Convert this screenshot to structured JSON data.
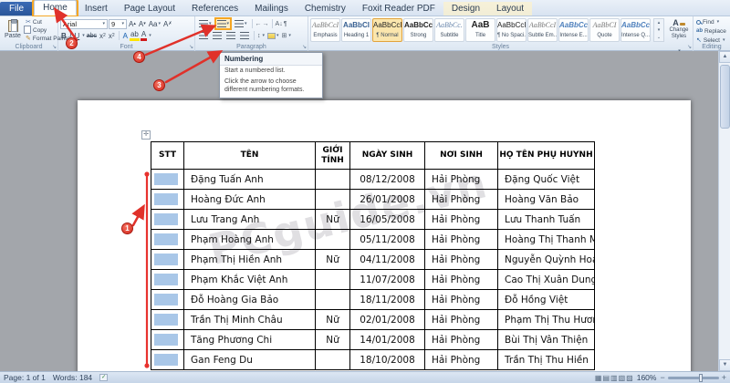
{
  "tabs": {
    "items": [
      {
        "label": "File",
        "file": true
      },
      {
        "label": "Home",
        "active": true
      },
      {
        "label": "Insert"
      },
      {
        "label": "Page Layout"
      },
      {
        "label": "References"
      },
      {
        "label": "Mailings"
      },
      {
        "label": "Chemistry"
      },
      {
        "label": "Foxit Reader PDF"
      },
      {
        "label": "Design",
        "ctx": true
      },
      {
        "label": "Layout",
        "ctx": true
      }
    ]
  },
  "ribbon": {
    "clipboard": {
      "label": "Clipboard",
      "paste": "Paste",
      "cut": "Cut",
      "copy": "Copy",
      "format_painter": "Format Painter"
    },
    "font": {
      "label": "Font",
      "family": "Arial",
      "size": "9"
    },
    "paragraph": {
      "label": "Paragraph"
    },
    "styles": {
      "label": "Styles",
      "change_styles": "Change Styles",
      "items": [
        {
          "sample": "AaBbCcI",
          "name": "Emphasis",
          "cls": "s-emph"
        },
        {
          "sample": "AaBbCI",
          "name": "Heading 1",
          "cls": "s-h1"
        },
        {
          "sample": "AaBbCcI",
          "name": "¶ Normal",
          "cls": "",
          "selected": true
        },
        {
          "sample": "AaBbCcI",
          "name": "Strong",
          "cls": "s-strong"
        },
        {
          "sample": "AaBbCc.",
          "name": "Subtitle",
          "cls": "s-sub"
        },
        {
          "sample": "AaB",
          "name": "Title",
          "cls": "s-title"
        },
        {
          "sample": "AaBbCcI",
          "name": "¶ No Spaci...",
          "cls": ""
        },
        {
          "sample": "AaBbCcI",
          "name": "Subtle Em...",
          "cls": "s-emph"
        },
        {
          "sample": "AaBbCcI",
          "name": "Intense E...",
          "cls": "s-iemph"
        },
        {
          "sample": "AaBbCI",
          "name": "Quote",
          "cls": "s-emph"
        },
        {
          "sample": "AaBbCcI",
          "name": "Intense Q...",
          "cls": "s-iemph"
        }
      ]
    },
    "editing": {
      "label": "Editing",
      "find": "Find",
      "replace": "Replace",
      "select": "Select"
    }
  },
  "tooltip": {
    "title": "Numbering",
    "body1": "Start a numbered list.",
    "body2": "Click the arrow to choose different numbering formats."
  },
  "document": {
    "watermark": "PCguide.vn",
    "table": {
      "headers": [
        "STT",
        "TÊN",
        "GIỚI TÍNH",
        "NGÀY SINH",
        "NƠI SINH",
        "HỌ TÊN PHỤ HUYNH"
      ],
      "rows": [
        [
          "",
          "Đặng Tuấn Anh",
          "",
          "08/12/2008",
          "Hải Phòng",
          "Đặng Quốc Việt"
        ],
        [
          "",
          "Hoàng Đức Anh",
          "",
          "26/01/2008",
          "Hải Phòng",
          "Hoàng Văn Bảo"
        ],
        [
          "",
          "Lưu Trang Anh",
          "Nữ",
          "16/05/2008",
          "Hải Phòng",
          "Lưu Thanh Tuấn"
        ],
        [
          "",
          "Phạm Hoàng Anh",
          "",
          "05/11/2008",
          "Hải Phòng",
          "Hoàng Thị Thanh Mai"
        ],
        [
          "",
          "Phạm Thị Hiền Anh",
          "Nữ",
          "04/11/2008",
          "Hải Phòng",
          "Nguyễn Quỳnh Hoa"
        ],
        [
          "",
          "Phạm Khắc Việt Anh",
          "",
          "11/07/2008",
          "Hải Phòng",
          "Cao Thị Xuân Dung"
        ],
        [
          "",
          "Đỗ Hoàng Gia Bảo",
          "",
          "18/11/2008",
          "Hải Phòng",
          "Đỗ Hồng Việt"
        ],
        [
          "",
          "Trần Thị Minh Châu",
          "Nữ",
          "02/01/2008",
          "Hải Phòng",
          "Phạm Thị Thu Hương"
        ],
        [
          "",
          "Tăng Phương Chi",
          "Nữ",
          "14/01/2008",
          "Hải Phòng",
          "Bùi Thị Vân Thiện"
        ],
        [
          "",
          "Gan Feng Du",
          "",
          "18/10/2008",
          "Hải Phòng",
          "Trần Thị Thu Hiền"
        ]
      ]
    }
  },
  "status": {
    "page": "Page: 1 of 1",
    "words": "Words: 184",
    "zoom": "160%"
  },
  "annotations": {
    "numbers": [
      "1",
      "2",
      "3",
      "4"
    ]
  }
}
